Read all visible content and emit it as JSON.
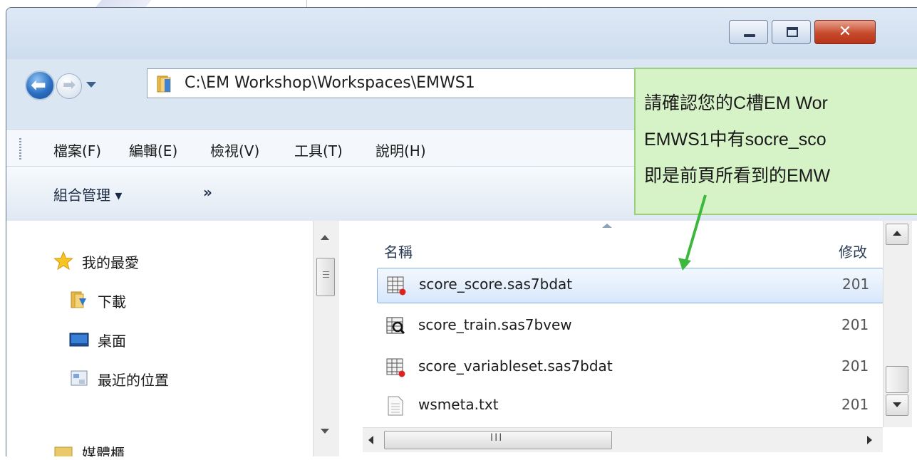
{
  "window": {
    "title_buttons": {
      "minimize": "minimize-icon",
      "maximize": "maximize-icon",
      "close": "✕"
    }
  },
  "address_bar": {
    "path": "C:\\EM Workshop\\Workspaces\\EMWS1"
  },
  "menu": {
    "items": [
      "檔案(F)",
      "編輯(E)",
      "檢視(V)",
      "工具(T)",
      "說明(H)"
    ]
  },
  "command_bar": {
    "organize": "組合管理 ▾",
    "more": "»"
  },
  "navigation_pane": {
    "items": [
      {
        "label": "我的最愛",
        "icon": "star-icon"
      },
      {
        "label": "下載",
        "icon": "downloads-folder-icon"
      },
      {
        "label": "桌面",
        "icon": "desktop-icon"
      },
      {
        "label": "最近的位置",
        "icon": "recent-places-icon"
      },
      {
        "label": "媒體櫃",
        "icon": "library-icon"
      }
    ]
  },
  "file_list": {
    "columns": {
      "name": "名稱",
      "modified": "修改"
    },
    "rows": [
      {
        "name": "score_score.sas7bdat",
        "date": "201",
        "icon": "sas-dataset-icon",
        "selected": true
      },
      {
        "name": "score_train.sas7bvew",
        "date": "201",
        "icon": "sas-view-icon",
        "selected": false
      },
      {
        "name": "score_variableset.sas7bdat",
        "date": "201",
        "icon": "sas-dataset-icon",
        "selected": false
      },
      {
        "name": "wsmeta.txt",
        "date": "201",
        "icon": "text-file-icon",
        "selected": false
      }
    ],
    "hscroll_grip": "III"
  },
  "callout": {
    "lines": [
      "請確認您的C槽EM Wor",
      "EMWS1中有socre_sco",
      "即是前頁所看到的EMW"
    ]
  },
  "colors": {
    "callout_bg": "#d6f3c7",
    "arrow": "#3cb83c",
    "selection": "#d7e7fb"
  }
}
